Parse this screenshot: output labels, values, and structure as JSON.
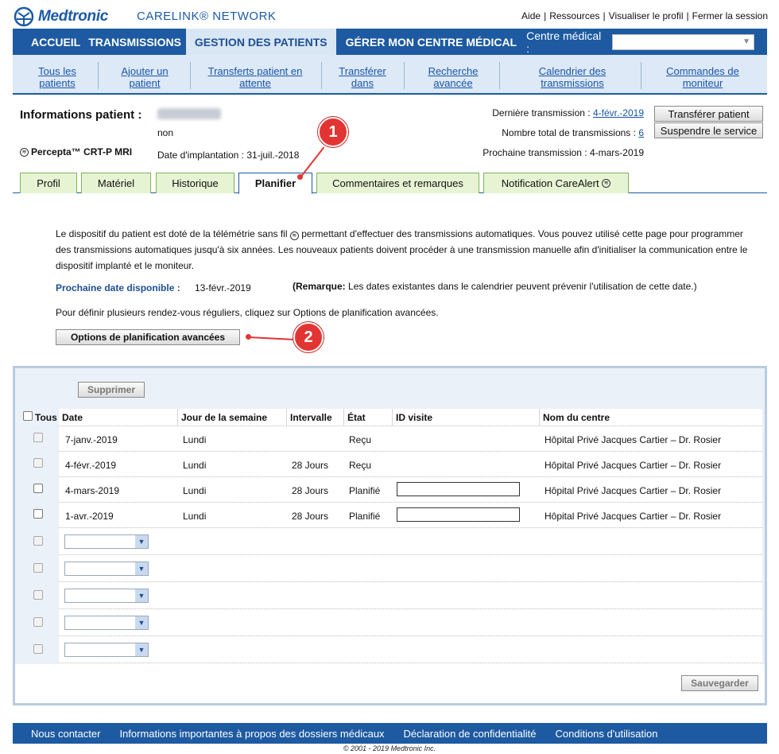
{
  "header": {
    "logo": "Medtronic",
    "network": "CARELINK® NETWORK",
    "top_links": [
      "Aide",
      "Ressources",
      "Visualiser le profil",
      "Fermer la session"
    ]
  },
  "main_nav": {
    "items": [
      "ACCUEIL",
      "TRANSMISSIONS",
      "GESTION DES PATIENTS",
      "GÉRER MON CENTRE MÉDICAL"
    ],
    "active": "GESTION DES PATIENTS",
    "centre_label": "Centre médical :",
    "centre_value": ""
  },
  "sub_nav": [
    {
      "l1": "Tous les",
      "l2": "patients"
    },
    {
      "l1": "Ajouter un",
      "l2": "patient"
    },
    {
      "l1": "Transferts patient en",
      "l2": "attente"
    },
    {
      "l1": "Transférer",
      "l2": "dans"
    },
    {
      "l1": "Recherche",
      "l2": "avancée"
    },
    {
      "l1": "Calendrier des",
      "l2": "transmissions"
    },
    {
      "l1": "Commandes de",
      "l2": "moniteur"
    }
  ],
  "patient": {
    "title": "Informations patient :",
    "subtitle": "non",
    "device": "Percepta™ CRT-P MRI",
    "implant": "Date d'implantation : 31-juil.-2018",
    "last_tx_label": "Dernière transmission :",
    "last_tx_value": "4-févr.-2019",
    "total_tx_label": "Nombre total de transmissions :",
    "total_tx_value": "6",
    "next_tx": "Prochaine transmission : 4-mars-2019",
    "btn_transfer": "Transférer patient",
    "btn_suspend": "Suspendre le service"
  },
  "tabs": [
    "Profil",
    "Matériel",
    "Historique",
    "Planifier",
    "Commentaires et remarques",
    "Notification CareAlert"
  ],
  "active_tab": "Planifier",
  "callouts": [
    "1",
    "2"
  ],
  "description": {
    "part1": "Le dispositif du patient est doté de la télémétrie sans fil",
    "part2": "permettant d'effectuer des transmissions automatiques. Vous pouvez utilisé cette page pour programmer des transmissions automatiques jusqu'à six années. Les nouveaux patients doivent procéder à une transmission manuelle afin d'initialiser la communication entre le dispositif implanté et le moniteur.",
    "next_label": "Prochaine date disponible :",
    "next_value": "13-févr.-2019",
    "remark_bold": "(Remarque:",
    "remark_text": "Les dates existantes dans le calendrier peuvent prévenir l'utilisation de cette date.)",
    "multi": "Pour définir plusieurs rendez-vous réguliers, cliquez sur Options de planification avancées.",
    "adv_button": "Options de planification avancées"
  },
  "schedule": {
    "delete_button": "Supprimer",
    "save_button": "Sauvegarder",
    "headers": [
      "Tous",
      "Date",
      "Jour de la semaine",
      "Intervalle",
      "État",
      "ID visite",
      "Nom du centre"
    ],
    "rows": [
      {
        "date": "7-janv.-2019",
        "day": "Lundi",
        "interval": "",
        "state": "Reçu",
        "centre": "Hôpital Privé Jacques Cartier – Dr. Rosier"
      },
      {
        "date": "4-févr.-2019",
        "day": "Lundi",
        "interval": "28 Jours",
        "state": "Reçu",
        "centre": "Hôpital Privé Jacques Cartier – Dr. Rosier"
      },
      {
        "date": "4-mars-2019",
        "day": "Lundi",
        "interval": "28 Jours",
        "state": "Planifié",
        "centre": "Hôpital Privé Jacques Cartier – Dr. Rosier"
      },
      {
        "date": "1-avr.-2019",
        "day": "Lundi",
        "interval": "28 Jours",
        "state": "Planifié",
        "centre": "Hôpital Privé Jacques Cartier – Dr. Rosier"
      }
    ]
  },
  "footer": {
    "links": [
      "Nous contacter",
      "Informations importantes à propos des dossiers médicaux",
      "Déclaration de confidentialité",
      "Conditions d'utilisation"
    ],
    "copyright": "© 2001 - 2019 Medtronic Inc."
  },
  "colors": {
    "brand": "#1d5aa1",
    "tab_green": "#e6f4d4",
    "callout": "#e33434"
  }
}
